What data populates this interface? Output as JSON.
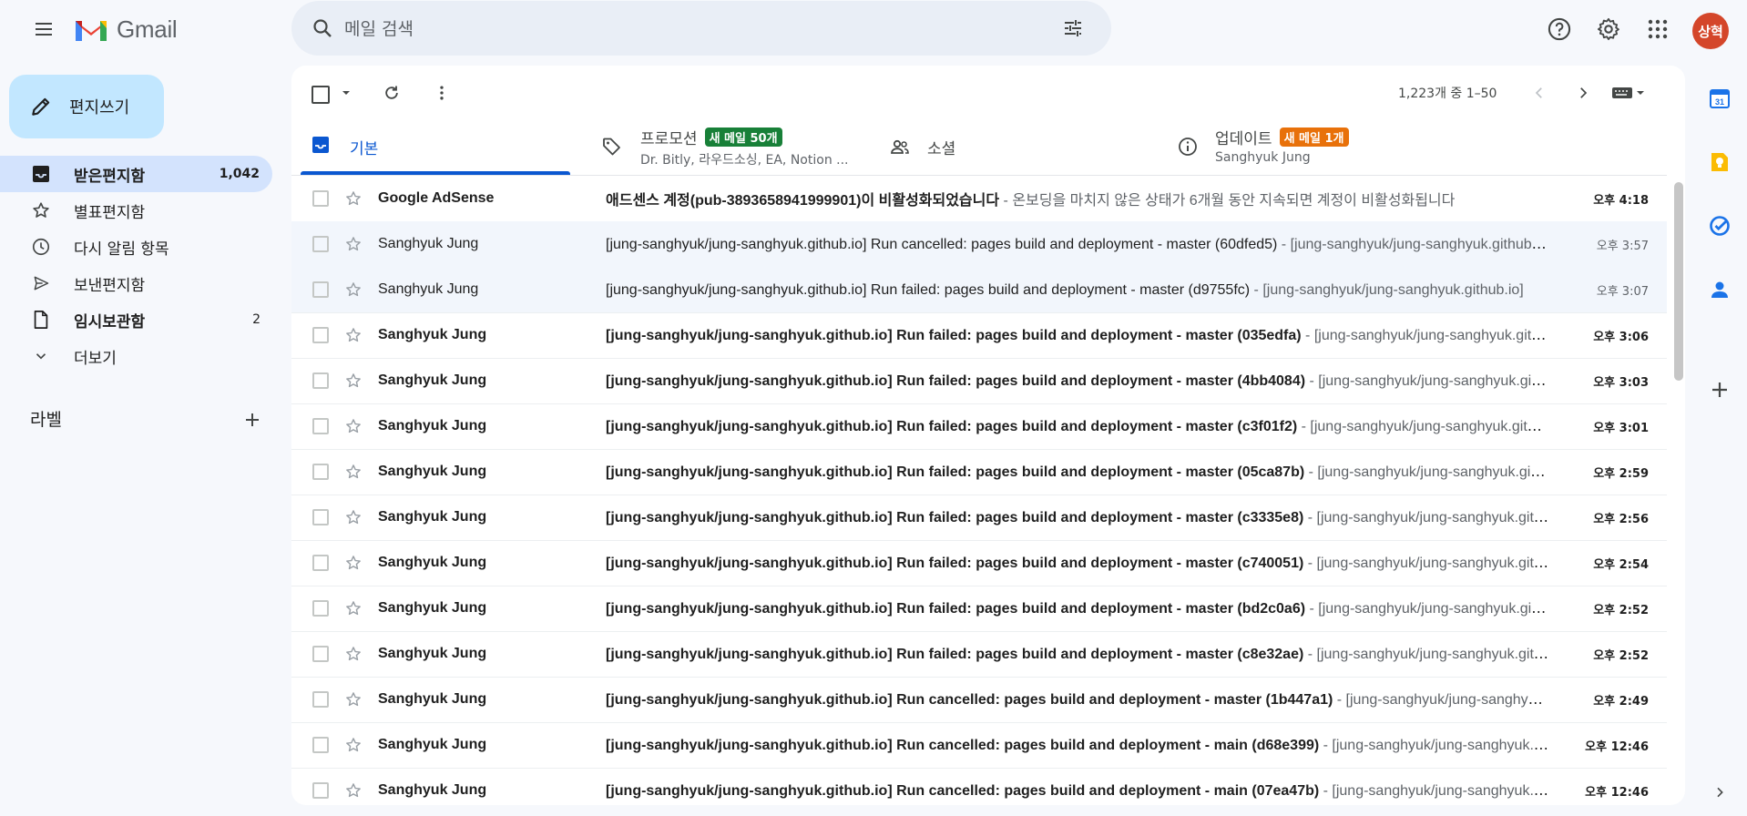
{
  "header": {
    "app_name": "Gmail",
    "search_placeholder": "메일 검색",
    "avatar_initials": "상혁",
    "avatar_color": "#d4462a"
  },
  "sidebar": {
    "compose_label": "편지쓰기",
    "items": [
      {
        "label": "받은편지함",
        "count": "1,042",
        "icon": "inbox-icon",
        "active": true
      },
      {
        "label": "별표편지함",
        "count": "",
        "icon": "star-icon"
      },
      {
        "label": "다시 알림 항목",
        "count": "",
        "icon": "clock-icon"
      },
      {
        "label": "보낸편지함",
        "count": "",
        "icon": "send-icon"
      },
      {
        "label": "임시보관함",
        "count": "2",
        "icon": "draft-icon",
        "bold": true
      },
      {
        "label": "더보기",
        "count": "",
        "icon": "chevron-down-icon"
      }
    ],
    "labels_heading": "라벨"
  },
  "toolbar": {
    "pagination": "1,223개 중 1–50"
  },
  "tabs": [
    {
      "title": "기본",
      "active": true,
      "icon": "inbox-icon"
    },
    {
      "title": "프로모션",
      "badge": "새 메일 50개",
      "badge_color": "#188038",
      "sub": "Dr. Bitly, 라우드소싱, EA, Notion ...",
      "icon": "tag-icon"
    },
    {
      "title": "소셜",
      "icon": "people-icon"
    },
    {
      "title": "업데이트",
      "badge": "새 메일 1개",
      "badge_color": "#e8710a",
      "sub": "Sanghyuk Jung",
      "icon": "info-icon"
    }
  ],
  "emails": [
    {
      "from": "Google AdSense",
      "subject": "애드센스 계정(pub-3893658941999901)이 비활성화되었습니다",
      "snippet": " - 온보딩을 마치지 않은 상태가 6개월 동안 지속되면 계정이 비활성화됩니다",
      "time": "오후 4:18",
      "unread": true
    },
    {
      "from": "Sanghyuk Jung",
      "subject": "[jung-sanghyuk/jung-sanghyuk.github.io] Run cancelled: pages build and deployment - master (60dfed5)",
      "snippet": " - [jung-sanghyuk/jung-sanghyuk.github.io]",
      "time": "오후 3:57",
      "unread": false
    },
    {
      "from": "Sanghyuk Jung",
      "subject": "[jung-sanghyuk/jung-sanghyuk.github.io] Run failed: pages build and deployment - master (d9755fc)",
      "snippet": " - [jung-sanghyuk/jung-sanghyuk.github.io]",
      "time": "오후 3:07",
      "unread": false
    },
    {
      "from": "Sanghyuk Jung",
      "subject": "[jung-sanghyuk/jung-sanghyuk.github.io] Run failed: pages build and deployment - master (035edfa)",
      "snippet": " - [jung-sanghyuk/jung-sanghyuk.github.io]",
      "time": "오후 3:06",
      "unread": true
    },
    {
      "from": "Sanghyuk Jung",
      "subject": "[jung-sanghyuk/jung-sanghyuk.github.io] Run failed: pages build and deployment - master (4bb4084)",
      "snippet": " - [jung-sanghyuk/jung-sanghyuk.github.io]",
      "time": "오후 3:03",
      "unread": true
    },
    {
      "from": "Sanghyuk Jung",
      "subject": "[jung-sanghyuk/jung-sanghyuk.github.io] Run failed: pages build and deployment - master (c3f01f2)",
      "snippet": " - [jung-sanghyuk/jung-sanghyuk.github.io]",
      "time": "오후 3:01",
      "unread": true
    },
    {
      "from": "Sanghyuk Jung",
      "subject": "[jung-sanghyuk/jung-sanghyuk.github.io] Run failed: pages build and deployment - master (05ca87b)",
      "snippet": " - [jung-sanghyuk/jung-sanghyuk.github.io]",
      "time": "오후 2:59",
      "unread": true
    },
    {
      "from": "Sanghyuk Jung",
      "subject": "[jung-sanghyuk/jung-sanghyuk.github.io] Run failed: pages build and deployment - master (c3335e8)",
      "snippet": " - [jung-sanghyuk/jung-sanghyuk.github.io]",
      "time": "오후 2:56",
      "unread": true
    },
    {
      "from": "Sanghyuk Jung",
      "subject": "[jung-sanghyuk/jung-sanghyuk.github.io] Run failed: pages build and deployment - master (c740051)",
      "snippet": " - [jung-sanghyuk/jung-sanghyuk.github.io]",
      "time": "오후 2:54",
      "unread": true
    },
    {
      "from": "Sanghyuk Jung",
      "subject": "[jung-sanghyuk/jung-sanghyuk.github.io] Run failed: pages build and deployment - master (bd2c0a6)",
      "snippet": " - [jung-sanghyuk/jung-sanghyuk.github.io]",
      "time": "오후 2:52",
      "unread": true
    },
    {
      "from": "Sanghyuk Jung",
      "subject": "[jung-sanghyuk/jung-sanghyuk.github.io] Run failed: pages build and deployment - master (c8e32ae)",
      "snippet": " - [jung-sanghyuk/jung-sanghyuk.github.io]",
      "time": "오후 2:52",
      "unread": true
    },
    {
      "from": "Sanghyuk Jung",
      "subject": "[jung-sanghyuk/jung-sanghyuk.github.io] Run cancelled: pages build and deployment - master (1b447a1)",
      "snippet": " - [jung-sanghyuk/jung-sanghyuk.github.io]",
      "time": "오후 2:49",
      "unread": true
    },
    {
      "from": "Sanghyuk Jung",
      "subject": "[jung-sanghyuk/jung-sanghyuk.github.io] Run cancelled: pages build and deployment - main (d68e399)",
      "snippet": " - [jung-sanghyuk/jung-sanghyuk.github.io]",
      "time": "오후 12:46",
      "unread": true
    },
    {
      "from": "Sanghyuk Jung",
      "subject": "[jung-sanghyuk/jung-sanghyuk.github.io] Run cancelled: pages build and deployment - main (07ea47b)",
      "snippet": " - [jung-sanghyuk/jung-sanghyuk.github.io]",
      "time": "오후 12:46",
      "unread": true
    }
  ]
}
